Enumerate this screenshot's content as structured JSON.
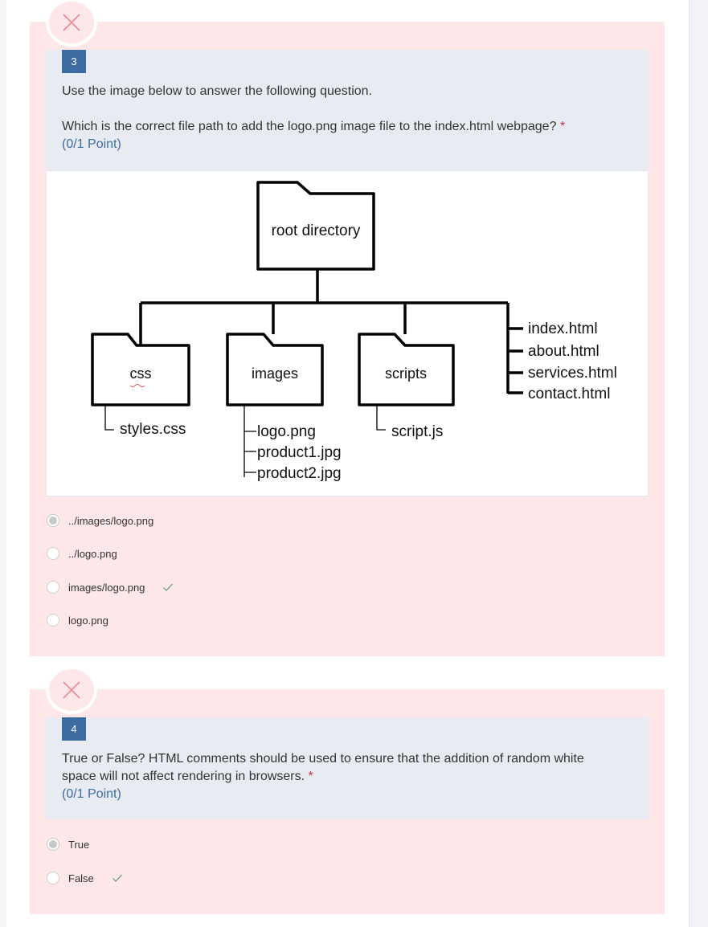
{
  "questions": [
    {
      "number": "3",
      "intro": "Use the image below to answer the following question.",
      "prompt": "Which is the correct file path to add the logo.png image file to the index.html webpage?",
      "required_mark": "*",
      "points": "(0/1 Point)",
      "result_icon": "x-icon",
      "figure": {
        "root": "root directory",
        "folders": [
          "css",
          "images",
          "scripts"
        ],
        "css_files": [
          "styles.css"
        ],
        "images_files": [
          "logo.png",
          "product1.jpg",
          "product2.jpg"
        ],
        "scripts_files": [
          "script.js"
        ],
        "root_files": [
          "index.html",
          "about.html",
          "services.html",
          "contact.html"
        ]
      },
      "options": [
        {
          "label": "../images/logo.png",
          "selected": true,
          "correct": false
        },
        {
          "label": "../logo.png",
          "selected": false,
          "correct": false
        },
        {
          "label": "images/logo.png",
          "selected": false,
          "correct": true
        },
        {
          "label": "logo.png",
          "selected": false,
          "correct": false
        }
      ]
    },
    {
      "number": "4",
      "prompt_line1": "True or False? HTML comments should be used to ensure that the addition of random white",
      "prompt_line2": "space will not affect rendering in browsers.",
      "required_mark": "*",
      "points": "(0/1 Point)",
      "result_icon": "x-icon",
      "options": [
        {
          "label": "True",
          "selected": true,
          "correct": false
        },
        {
          "label": "False",
          "selected": false,
          "correct": true
        }
      ]
    }
  ],
  "colors": {
    "card_background": "#fde7e9",
    "question_panel": "#e8ebf2",
    "number_badge": "#3c6ca0",
    "wrong_icon": "#f08a96",
    "correct_check": "#5b9a6d",
    "required": "#c4314b"
  }
}
